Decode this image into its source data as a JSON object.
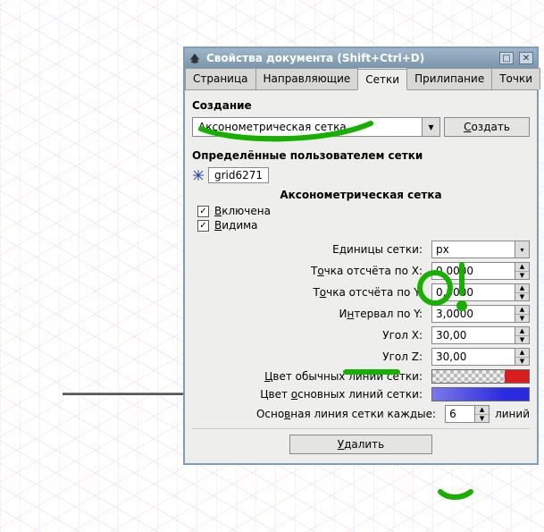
{
  "window": {
    "title": "Свойства документа (Shift+Ctrl+D)"
  },
  "tabs": [
    "Страница",
    "Направляющие",
    "Сетки",
    "Прилипание",
    "Точки"
  ],
  "active_tab_index": 2,
  "creation": {
    "title": "Создание",
    "grid_type": "Аксонометрическая сетка",
    "create_btn": "Создать"
  },
  "user_grids": {
    "title": "Определённые пользователем сетки",
    "grid_id": "grid6271",
    "grid_type_title": "Аксонометрическая сетка"
  },
  "checks": {
    "enabled": {
      "label": "Включена",
      "checked": true
    },
    "visible": {
      "label": "Видима",
      "checked": true
    }
  },
  "unit": {
    "label": "Единицы сетки:",
    "value": "px"
  },
  "fields": {
    "origin_x": {
      "label": "Точка отсчёта по X:",
      "value": "0,0000"
    },
    "origin_y": {
      "label": "Точка отсчёта по Y:",
      "value": "0,0000"
    },
    "interval_y": {
      "label": "Интервал по Y:",
      "value": "3,0000"
    },
    "angle_x": {
      "label": "Угол X:",
      "value": "30,00"
    },
    "angle_z": {
      "label": "Угол Z:",
      "value": "30,00"
    }
  },
  "colors": {
    "minor": {
      "label": "Цвет обычных линий сетки:",
      "color": "#d81e1e",
      "alpha_checker": true
    },
    "major": {
      "label": "Цвет основных линий сетки:",
      "color": "#2a2ae0",
      "fade": true
    }
  },
  "major_every": {
    "label_prefix": "Основная линия сетки каждые:",
    "value": "6",
    "label_suffix": "линий"
  },
  "delete_btn": "Удалить"
}
